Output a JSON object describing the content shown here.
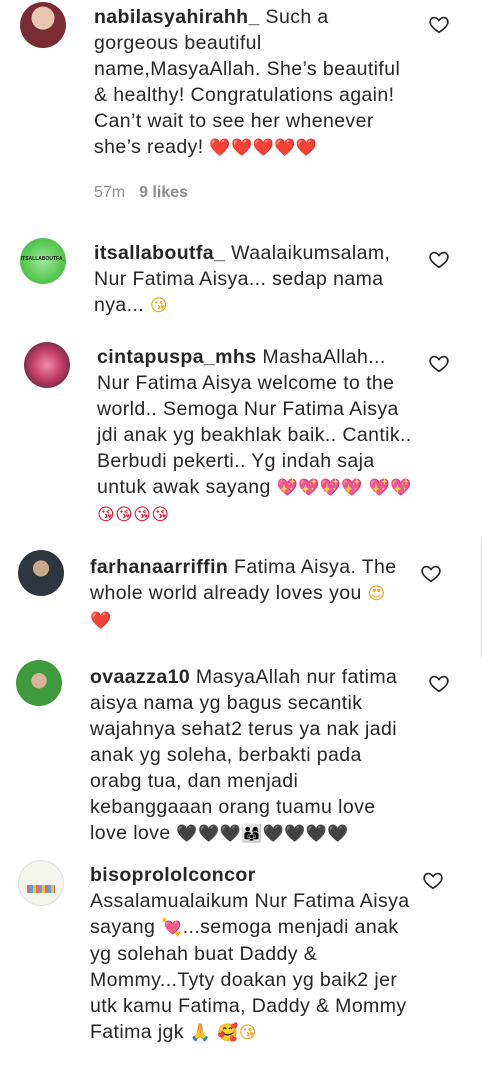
{
  "comments": [
    {
      "username": "nabilasyahirahh_",
      "text": "Such a gorgeous beautiful name,MasyaAllah. She’s beautiful & healthy! Congratulations again! Can’t wait to see her whenever she’s ready!",
      "emojis": "❤️❤️❤️❤️❤️",
      "time": "57m",
      "likes": "9 likes",
      "avatar_color": "#6a2a2e"
    },
    {
      "username": "itsallaboutfa_",
      "text": "Waalaikumsalam, Nur Fatima Aisya... sedap nama nya...",
      "emojis": "😘",
      "avatar_text": "ITSALLABOUTFA_",
      "avatar_color": "#4fc24a"
    },
    {
      "username": "cintapuspa_mhs",
      "text": "MashaAllah... Nur Fatima Aisya welcome to the world.. Semoga Nur Fatima Aisya jdi anak yg beakhlak baik.. Cantik.. Berbudi pekerti.. Yg indah saja untuk awak sayang",
      "emojis": "💖💖💖💖",
      "emojis2": "💖💖😘😘😘😘",
      "avatar_color": "#b23a5e"
    },
    {
      "username": "farhanaarriffin",
      "text": "Fatima Aisya. The whole world already loves you",
      "emojis": "😍",
      "emojis2": "❤️",
      "avatar_color": "#3a3f4a"
    },
    {
      "username": "ovaazza10",
      "text": "MasyaAllah nur fatima aisya nama yg bagus secantik wajahnya sehat2 terus ya nak jadi anak yg soleha, berbakti pada orabg tua, dan menjadi kebanggaaan orang tuamu love love love",
      "emojis": "🖤🖤🖤👨‍👩‍👧🖤🖤🖤🖤",
      "avatar_color": "#3c8a3a"
    },
    {
      "username": "bisoprololconcor",
      "text": "Assalamualaikum Nur Fatima Aisya sayang",
      "emojis": "💘",
      "text2": "...semoga menjadi anak yg solehah buat Daddy & Mommy...Tyty doakan yg baik2 jer utk kamu Fatima, Daddy & Mommy Fatima jgk",
      "emojis2": "🙏",
      "emojis3": "🥰😘",
      "avatar_color": "#f4f4f0"
    }
  ]
}
